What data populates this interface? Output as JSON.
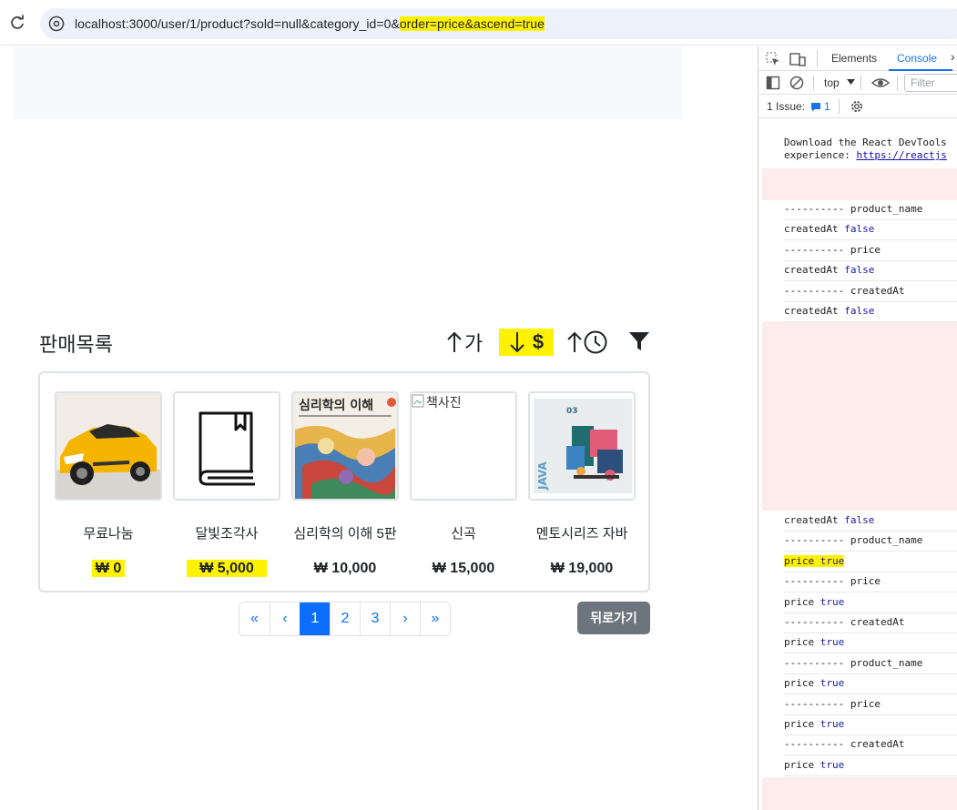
{
  "browser": {
    "url_plain": "localhost:3000/user/1/product?sold=null&category_id=0&",
    "url_highlight": "order=price&ascend=true"
  },
  "page": {
    "title": "판매목록",
    "sort_name_label": "가",
    "sort_price_label": "$",
    "products": [
      {
        "name": "무료나눔",
        "price": "₩ 0",
        "image": "yellow sports car photo",
        "highlighted": true
      },
      {
        "name": "달빛조각사",
        "price": "₩ 5,000",
        "image": "book-icon",
        "highlighted": true
      },
      {
        "name": "심리학의 이해 5판",
        "price": "₩ 10,000",
        "image": "심리학의 이해 book cover",
        "cover_title": "심리학의 이해",
        "highlighted": false
      },
      {
        "name": "신곡",
        "price": "₩ 15,000",
        "image": "broken image",
        "alt": "책사진",
        "highlighted": false
      },
      {
        "name": "멘토시리즈 자바",
        "price": "₩ 19,000",
        "image": "JAVA book cover",
        "cover_spine": "JAVA",
        "highlighted": false
      }
    ],
    "pagination": [
      "«",
      "‹",
      "1",
      "2",
      "3",
      "›",
      "»"
    ],
    "active_page": "1",
    "back_button": "뒤로가기"
  },
  "devtools": {
    "tabs": [
      "Elements",
      "Console"
    ],
    "active_tab": "Console",
    "context": "top",
    "filter_placeholder": "Filter",
    "issues_label": "1 Issue:",
    "issues_count": "1",
    "message_line1": "Download the React DevTools",
    "message_line2_prefix": "experience: ",
    "message_link": "https://reactjs",
    "logs": [
      {
        "text": "---------- product_name",
        "kw": ""
      },
      {
        "text": "createdAt ",
        "kw": "false"
      },
      {
        "text": "---------- price",
        "kw": ""
      },
      {
        "text": "createdAt ",
        "kw": "false"
      },
      {
        "text": "---------- createdAt",
        "kw": ""
      },
      {
        "text": "createdAt ",
        "kw": "false"
      },
      {
        "text": "createdAt ",
        "kw": "false"
      },
      {
        "text": "---------- product_name",
        "kw": ""
      },
      {
        "text": "price ",
        "kw": "true"
      },
      {
        "text": "---------- price",
        "kw": ""
      },
      {
        "text": "price ",
        "kw": "true"
      },
      {
        "text": "---------- createdAt",
        "kw": ""
      },
      {
        "text": "price ",
        "kw": "true"
      },
      {
        "text": "---------- product_name",
        "kw": ""
      },
      {
        "text": "price ",
        "kw": "true"
      },
      {
        "text": "---------- price",
        "kw": ""
      },
      {
        "text": "price ",
        "kw": "true"
      },
      {
        "text": "---------- createdAt",
        "kw": ""
      },
      {
        "text": "price ",
        "kw": "true"
      }
    ]
  },
  "colors": {
    "highlight": "#fff200",
    "primary": "#0d6efd",
    "secondary_button": "#6c757d",
    "error_band": "#fceceb"
  }
}
